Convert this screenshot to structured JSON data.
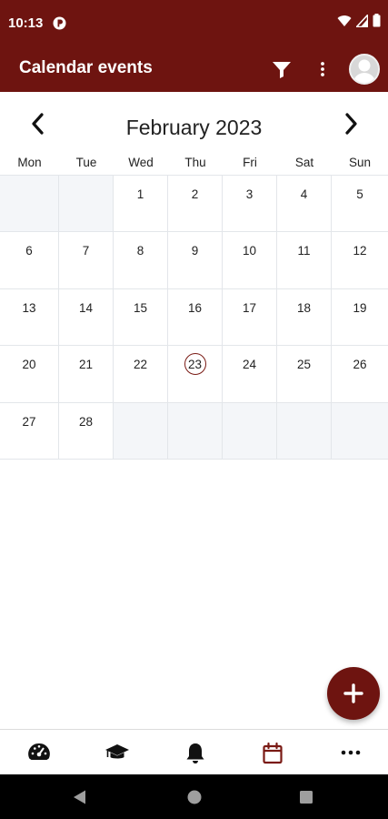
{
  "status_bar": {
    "time": "10:13",
    "icons": [
      "app-notification-icon",
      "wifi-icon",
      "signal-icon",
      "battery-icon"
    ]
  },
  "app_bar": {
    "title": "Calendar events",
    "actions": [
      "filter-icon",
      "more-vert-icon",
      "avatar"
    ]
  },
  "calendar": {
    "month_title": "February 2023",
    "weekdays": [
      "Mon",
      "Tue",
      "Wed",
      "Thu",
      "Fri",
      "Sat",
      "Sun"
    ],
    "weeks": [
      [
        "",
        "",
        "1",
        "2",
        "3",
        "4",
        "5"
      ],
      [
        "6",
        "7",
        "8",
        "9",
        "10",
        "11",
        "12"
      ],
      [
        "13",
        "14",
        "15",
        "16",
        "17",
        "18",
        "19"
      ],
      [
        "20",
        "21",
        "22",
        "23",
        "24",
        "25",
        "26"
      ],
      [
        "27",
        "28",
        "",
        "",
        "",
        "",
        ""
      ]
    ],
    "today": "23",
    "prev_icon": "chevron-left-icon",
    "next_icon": "chevron-right-icon"
  },
  "fab": {
    "icon": "plus-icon"
  },
  "bottom_nav": {
    "items": [
      "dashboard-icon",
      "graduation-cap-icon",
      "bell-icon",
      "calendar-icon",
      "more-horiz-icon"
    ],
    "active": "calendar-icon"
  },
  "system_nav": [
    "back-icon",
    "home-icon",
    "recents-icon"
  ],
  "colors": {
    "primary": "#6e1410",
    "empty_cell": "#f4f6f9",
    "grid_line": "#e3e6ea",
    "active_nav": "#7a1a14"
  }
}
